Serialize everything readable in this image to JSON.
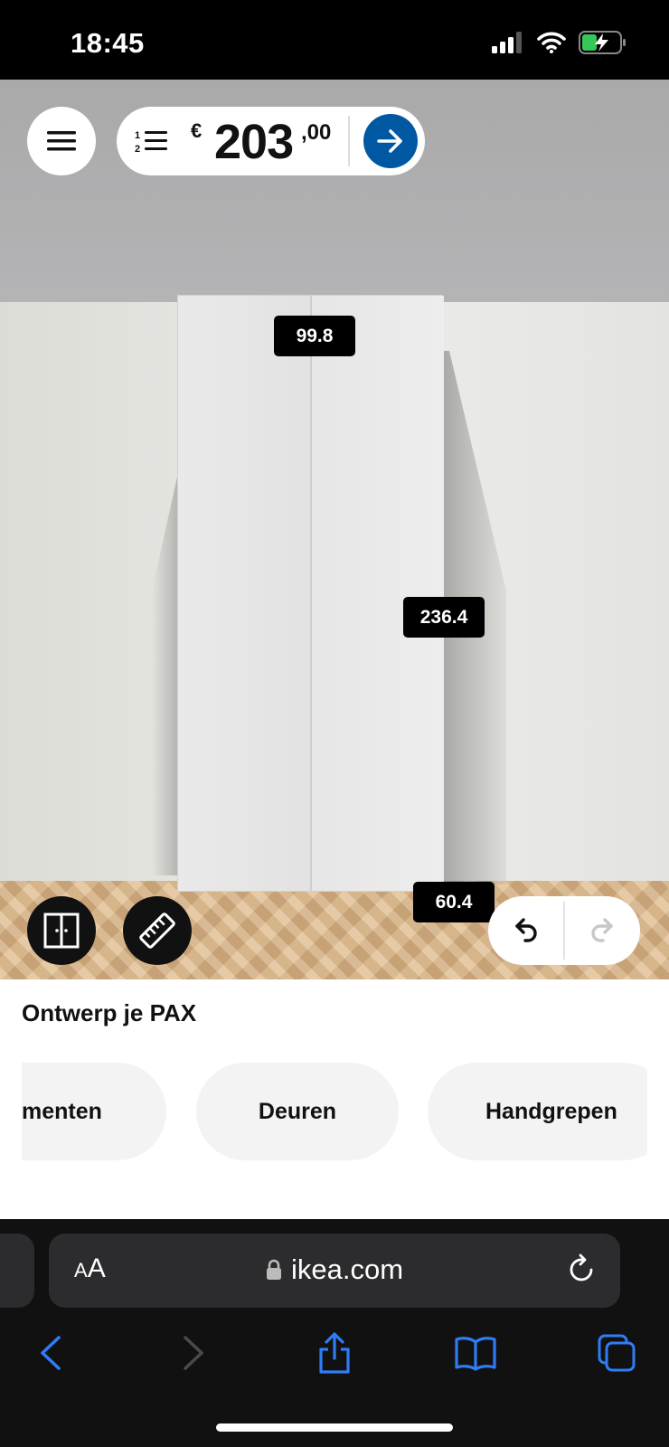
{
  "status_bar": {
    "time": "18:45"
  },
  "scene": {
    "dimensions": {
      "width": "99.8",
      "height": "236.4",
      "depth": "60.4"
    }
  },
  "toolbar": {
    "currency": "€",
    "price_whole": "203",
    "price_cents": ",00"
  },
  "panel": {
    "title": "Ontwerp je PAX",
    "chips": [
      "menten",
      "Deuren",
      "Handgrepen"
    ]
  },
  "browser": {
    "aa_small": "A",
    "aa_large": "A",
    "url": "ikea.com"
  },
  "colors": {
    "accent": "#0058a3",
    "browser_blue": "#2f7df6"
  }
}
